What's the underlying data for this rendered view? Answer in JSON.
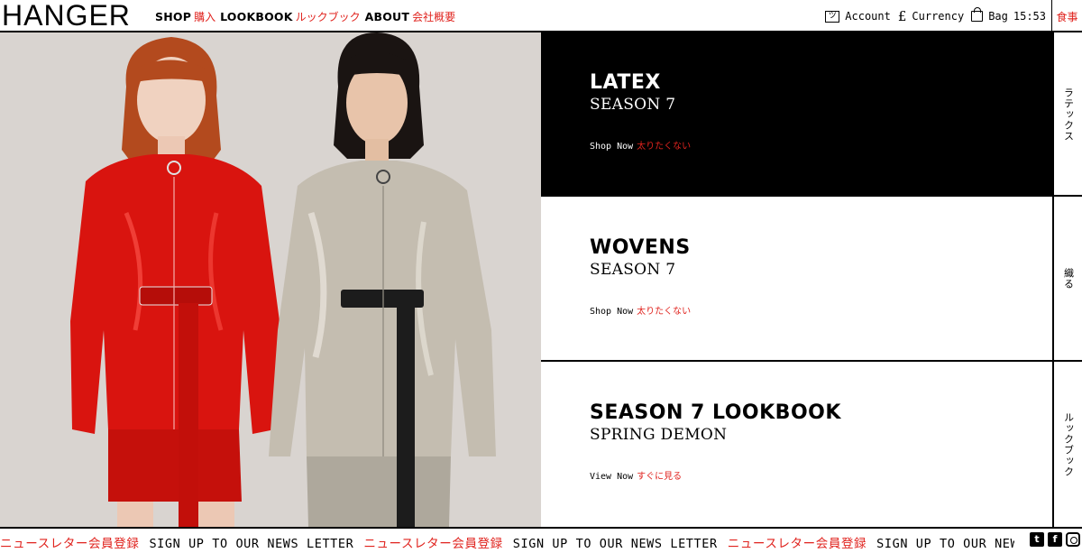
{
  "brand": {
    "logo": "HANGER"
  },
  "nav": [
    {
      "label": "SHOP",
      "jp": "購入"
    },
    {
      "label": "LOOKBOOK",
      "jp": "ルックブック"
    },
    {
      "label": "ABOUT",
      "jp": "会社概要"
    }
  ],
  "utility": {
    "account_icon": "ツ",
    "account": "Account",
    "currency_icon": "£",
    "currency": "Currency",
    "bag": "Bag",
    "clock": "15:53",
    "food": "食事"
  },
  "panels": [
    {
      "title": "LATEX",
      "subtitle": "SEASON 7",
      "cta": "Shop Now",
      "cta_jp": "太りたくない",
      "side": "ラテックス"
    },
    {
      "title": "WOVENS",
      "subtitle": "SEASON 7",
      "cta": "Shop Now",
      "cta_jp": "太りたくない",
      "side": "織る"
    },
    {
      "title": "SEASON 7 LOOKBOOK",
      "subtitle": "SPRING DEMON",
      "cta": "View Now",
      "cta_jp": "すぐに見る",
      "side": "ルックブック"
    }
  ],
  "footer": {
    "ticker_jp": "ニュースレター会員登録",
    "ticker_en": "SIGN UP TO OUR NEWS LETTER",
    "ticker_en_cut": "SIGN UP TO OUR NEWS",
    "social": {
      "tumblr": "t",
      "facebook": "f"
    }
  },
  "colors": {
    "accent": "#e0231e",
    "ink": "#000000",
    "paper": "#ffffff",
    "backdrop": "#d8d3cf"
  }
}
